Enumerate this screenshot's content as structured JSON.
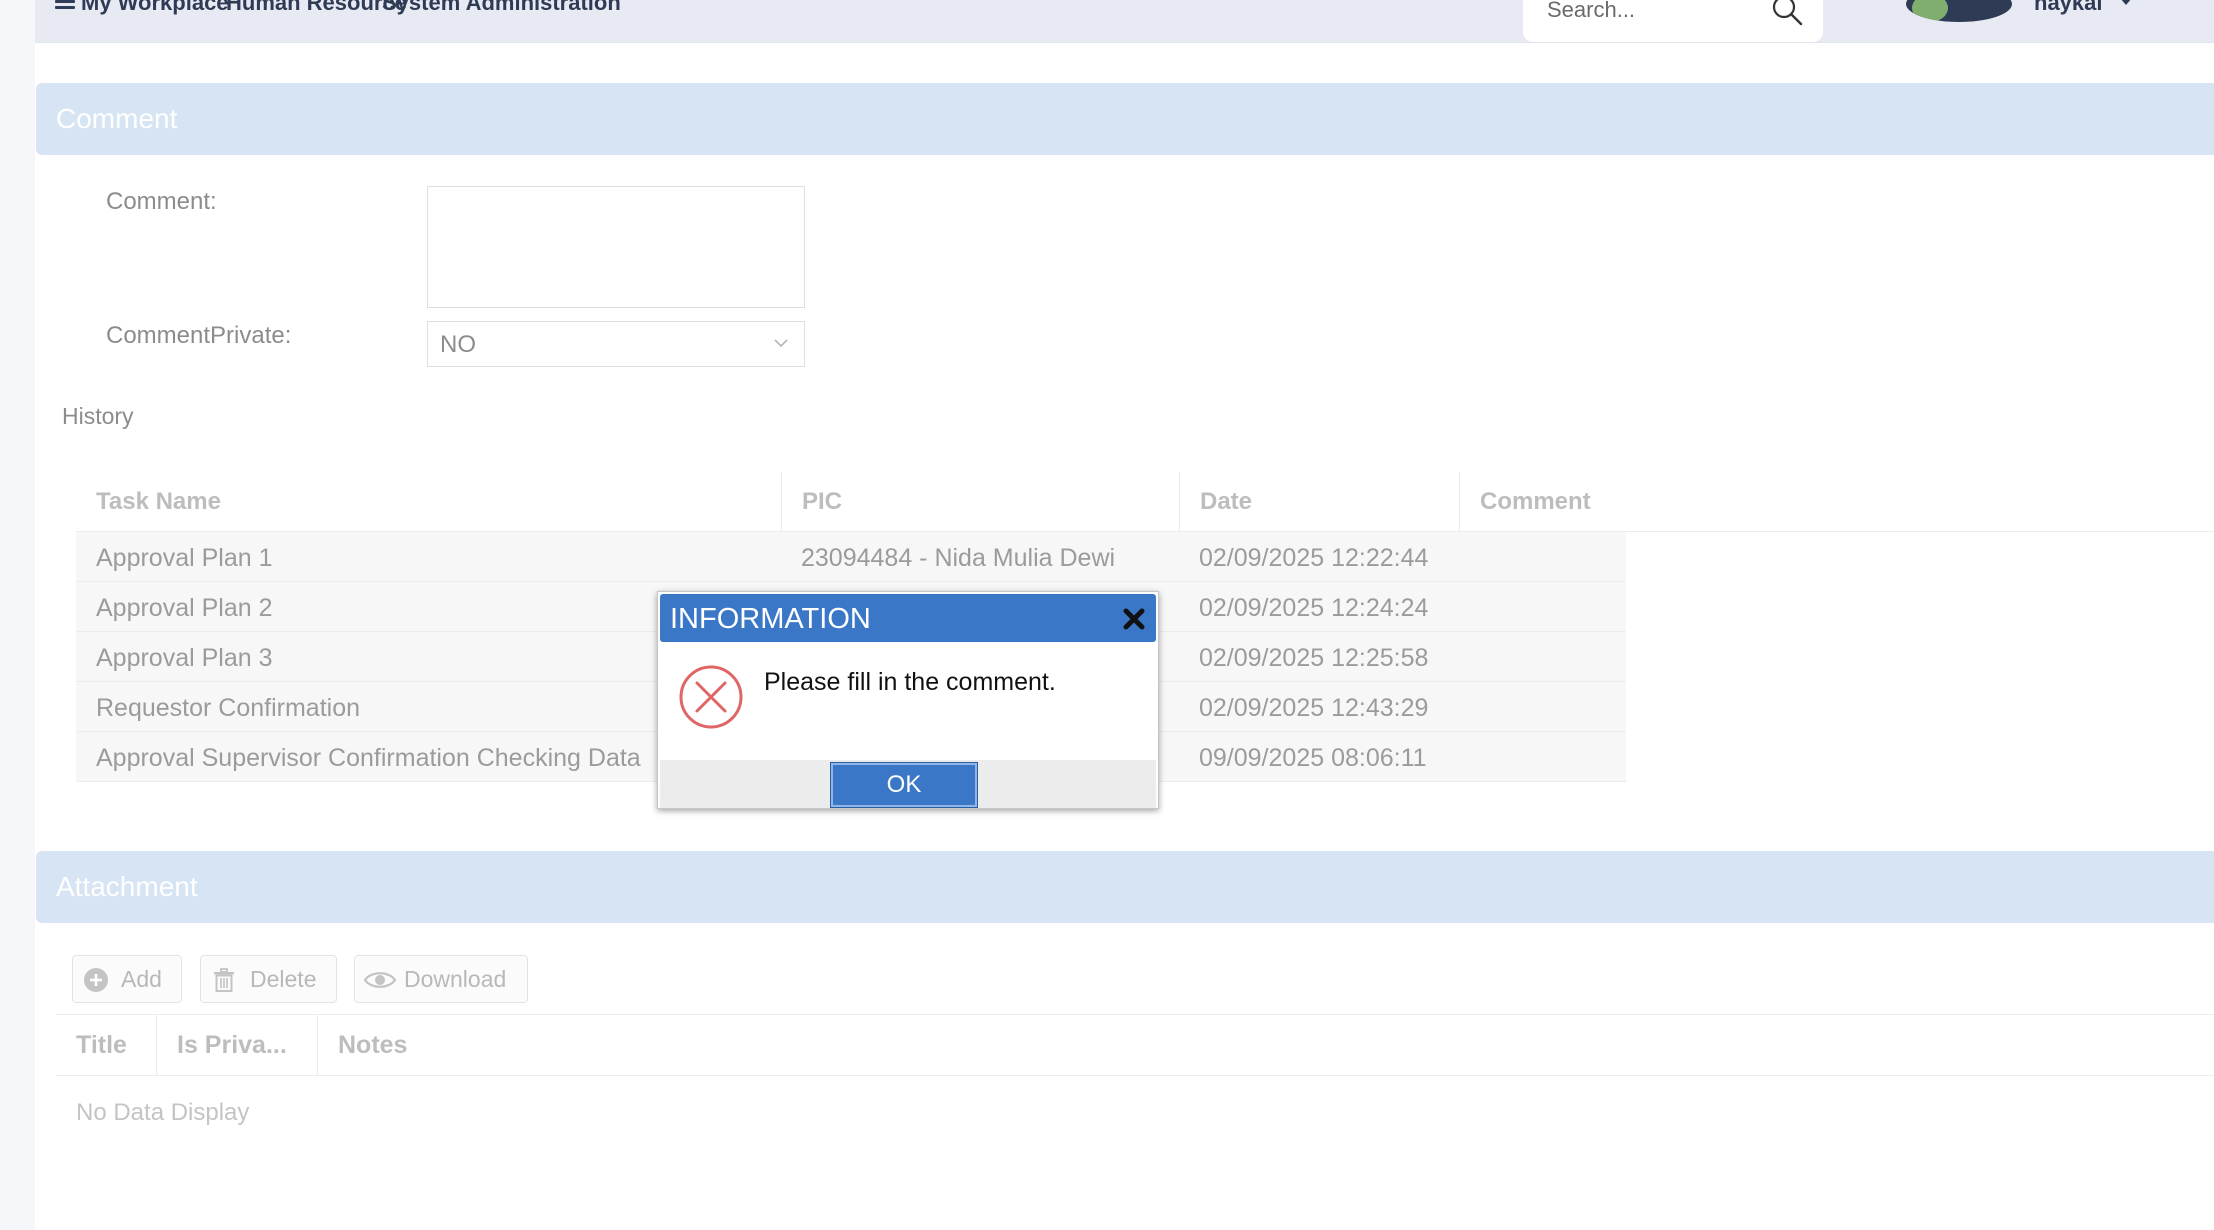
{
  "topnav": {
    "items": [
      "My Workplace",
      "Human Resource",
      "System Administration"
    ],
    "search_placeholder": "Search...",
    "user_name": "haykal"
  },
  "comment_section": {
    "title": "Comment",
    "comment_label": "Comment:",
    "comment_value": "",
    "private_label": "CommentPrivate:",
    "private_value": "NO",
    "history_label": "History"
  },
  "history": {
    "columns": [
      "Task Name",
      "PIC",
      "Date",
      "Comment"
    ],
    "rows": [
      {
        "task": "Approval Plan 1",
        "pic": "23094484 - Nida Mulia Dewi",
        "date": "02/09/2025 12:22:44",
        "comment": ""
      },
      {
        "task": "Approval Plan 2",
        "pic": "",
        "date": "02/09/2025 12:24:24",
        "comment": ""
      },
      {
        "task": "Approval Plan 3",
        "pic": "",
        "date": "02/09/2025 12:25:58",
        "comment": ""
      },
      {
        "task": "Requestor Confirmation",
        "pic": "",
        "date": "02/09/2025 12:43:29",
        "comment": ""
      },
      {
        "task": "Approval Supervisor Confirmation Checking Data",
        "pic": "",
        "date": "09/09/2025 08:06:11",
        "comment": ""
      }
    ]
  },
  "attachment_section": {
    "title": "Attachment",
    "add_label": "Add",
    "delete_label": "Delete",
    "download_label": "Download",
    "columns": [
      "Title",
      "Is Priva...",
      "Notes"
    ],
    "empty_text": "No Data Display"
  },
  "dialog": {
    "title": "INFORMATION",
    "message": "Please fill in the comment.",
    "ok_label": "OK"
  },
  "colors": {
    "dialog_blue": "#3a78c7",
    "section_header": "#d6e4f3",
    "error_red": "#e06666"
  },
  "icons": [
    "menu-icon",
    "search-icon",
    "chevron-down-icon",
    "plus-circle-icon",
    "trash-icon",
    "eye-icon",
    "close-icon",
    "error-icon"
  ]
}
